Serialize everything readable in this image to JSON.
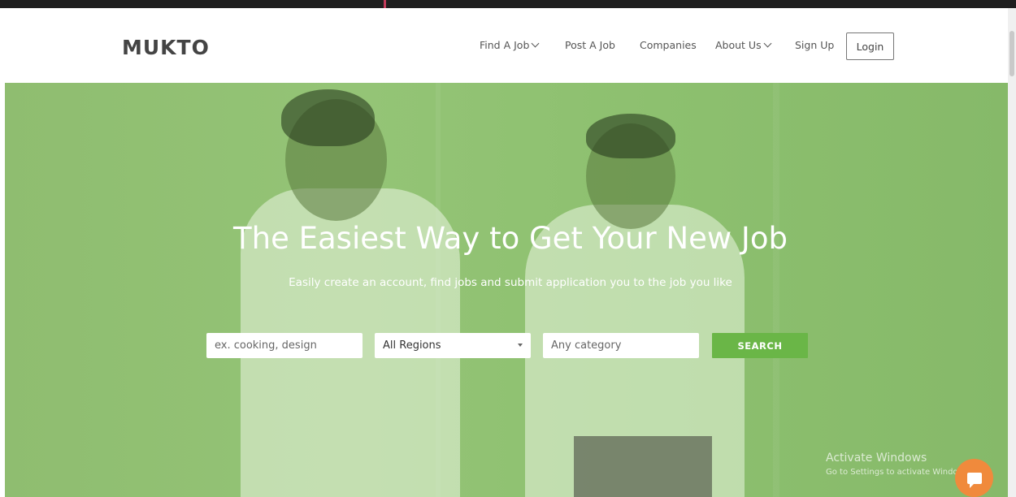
{
  "brand": {
    "logo": "MUKTO"
  },
  "nav": {
    "find_job": "Find A Job",
    "post_job": "Post A Job",
    "companies": "Companies",
    "about_us": "About Us",
    "sign_up": "Sign Up",
    "login": "Login"
  },
  "hero": {
    "title": "The Easiest Way to Get Your New Job",
    "subtitle": "Easily create an account, find jobs and submit application you to the job you like"
  },
  "search": {
    "keyword_placeholder": "ex. cooking, design",
    "region_selected": "All Regions",
    "category_placeholder": "Any category",
    "button_label": "SEARCH"
  },
  "watermark": {
    "line1": "Activate Windows",
    "line2": "Go to Settings to activate Windows."
  },
  "colors": {
    "accent": "#6ab647",
    "chat": "#f08a3c",
    "hero_tint": "#8fbd70"
  },
  "icons": {
    "chat": "chat-icon",
    "dropdown": "chevron-down-icon"
  }
}
